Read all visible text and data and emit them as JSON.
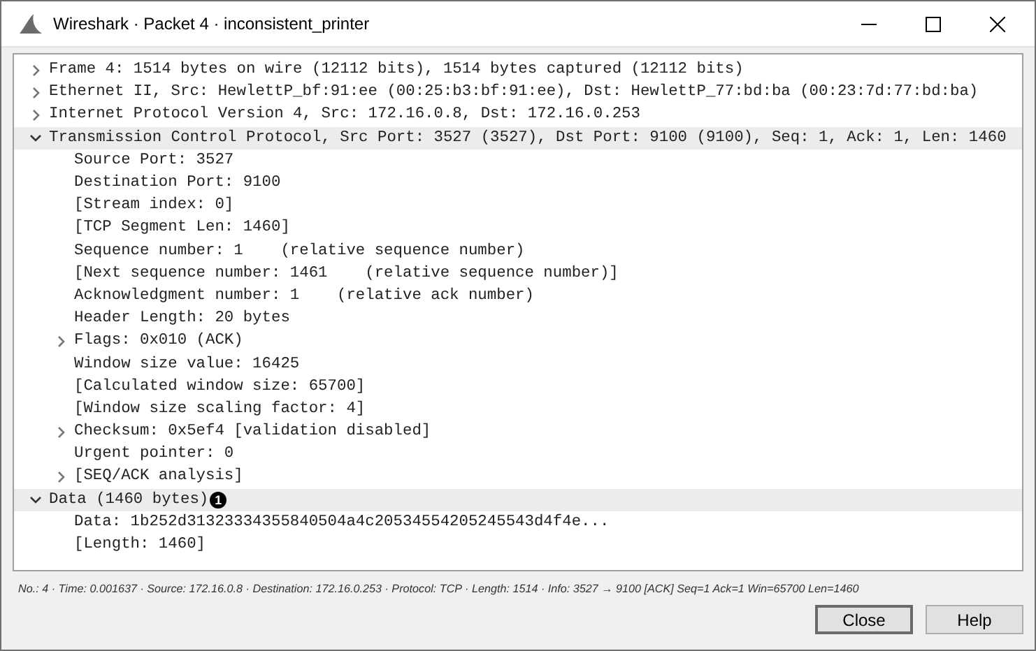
{
  "window": {
    "title": "Wireshark · Packet 4 · inconsistent_printer"
  },
  "tree": [
    {
      "label": "Frame 4: 1514 bytes on wire (12112 bits), 1514 bytes captured (12112 bits)",
      "expanded": false
    },
    {
      "label": "Ethernet II, Src: HewlettP_bf:91:ee (00:25:b3:bf:91:ee), Dst: HewlettP_77:bd:ba (00:23:7d:77:bd:ba)",
      "expanded": false
    },
    {
      "label": "Internet Protocol Version 4, Src: 172.16.0.8, Dst: 172.16.0.253",
      "expanded": false
    },
    {
      "label": "Transmission Control Protocol, Src Port: 3527 (3527), Dst Port: 9100 (9100), Seq: 1, Ack: 1, Len: 1460",
      "expanded": true,
      "children": [
        {
          "label": "Source Port: 3527"
        },
        {
          "label": "Destination Port: 9100"
        },
        {
          "label": "[Stream index: 0]"
        },
        {
          "label": "[TCP Segment Len: 1460]"
        },
        {
          "label": "Sequence number: 1    (relative sequence number)"
        },
        {
          "label": "[Next sequence number: 1461    (relative sequence number)]"
        },
        {
          "label": "Acknowledgment number: 1    (relative ack number)"
        },
        {
          "label": "Header Length: 20 bytes"
        },
        {
          "label": "Flags: 0x010 (ACK)",
          "expanded": false
        },
        {
          "label": "Window size value: 16425"
        },
        {
          "label": "[Calculated window size: 65700]"
        },
        {
          "label": "[Window size scaling factor: 4]"
        },
        {
          "label": "Checksum: 0x5ef4 [validation disabled]",
          "expanded": false
        },
        {
          "label": "Urgent pointer: 0"
        },
        {
          "label": "[SEQ/ACK analysis]",
          "expanded": false
        }
      ]
    },
    {
      "label": "Data (1460 bytes)",
      "marker": "1",
      "expanded": true,
      "children": [
        {
          "label": "Data: 1b252d31323334355840504a4c20534554205245543d4f4e..."
        },
        {
          "label": "[Length: 1460]"
        }
      ]
    }
  ],
  "status_bar": "No.: 4 · Time: 0.001637 · Source: 172.16.0.8 · Destination: 172.16.0.253 · Protocol: TCP · Length: 1514 · Info: 3527 → 9100 [ACK] Seq=1 Ack=1 Win=65700 Len=1460",
  "buttons": [
    "Close",
    "Help"
  ]
}
